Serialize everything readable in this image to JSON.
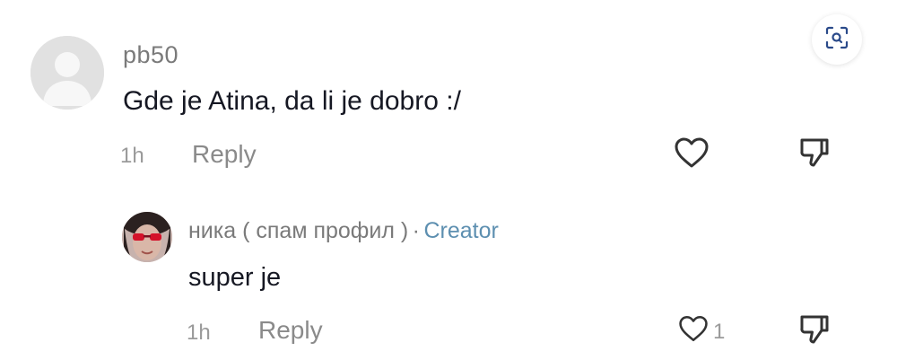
{
  "parent_comment": {
    "username": "pb50",
    "text": "Gde je Atina, da li je dobro :/",
    "time": "1h",
    "reply_label": "Reply",
    "icons": {
      "avatar": "default-avatar-icon",
      "like": "heart-outline-icon",
      "dislike": "thumbs-down-icon"
    }
  },
  "reply_comment": {
    "username": "ника ( спам профил )",
    "separator": "·",
    "badge": "Creator",
    "text": "super je",
    "time": "1h",
    "reply_label": "Reply",
    "like_count": "1",
    "icons": {
      "avatar": "user-photo-avatar",
      "like": "heart-outline-icon",
      "dislike": "thumbs-down-icon"
    }
  },
  "toolbar": {
    "lens_icon": "visual-search-icon"
  },
  "colors": {
    "text_primary": "#161823",
    "text_secondary": "#7a7a7a",
    "creator_accent": "#5d8fb0"
  }
}
